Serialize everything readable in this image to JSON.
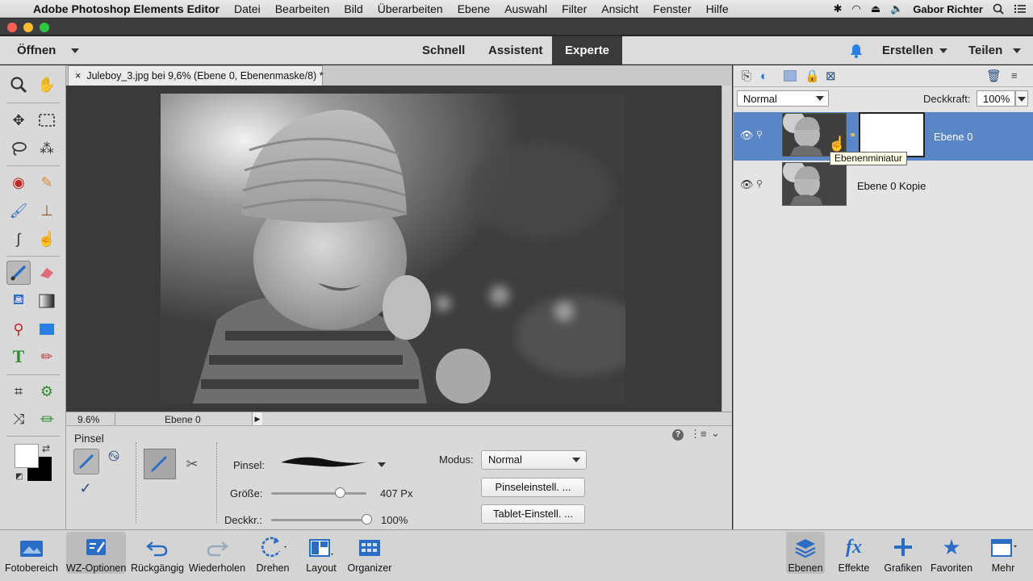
{
  "menubar": {
    "apple": "",
    "app": "Adobe Photoshop Elements Editor",
    "items": [
      "Datei",
      "Bearbeiten",
      "Bild",
      "Überarbeiten",
      "Ebene",
      "Auswahl",
      "Filter",
      "Ansicht",
      "Fenster",
      "Hilfe"
    ],
    "user": "Gabor Richter"
  },
  "topbar": {
    "open": "Öffnen",
    "modes": [
      "Schnell",
      "Assistent",
      "Experte"
    ],
    "active_mode": "Experte",
    "create": "Erstellen",
    "share": "Teilen"
  },
  "document": {
    "tab_close": "×",
    "tab_title": "Juleboy_3.jpg bei 9,6% (Ebene 0, Ebenenmaske/8) *",
    "zoom": "9.6%",
    "status_layer": "Ebene 0"
  },
  "options": {
    "tool_name": "Pinsel",
    "brush_label": "Pinsel:",
    "size_label": "Größe:",
    "size_value": "407 Px",
    "size_fraction": 0.72,
    "opacity_label": "Deckkr.:",
    "opacity_value": "100%",
    "opacity_fraction": 1.0,
    "mode_label": "Modus:",
    "mode_value": "Normal",
    "brush_settings": "Pinseleinstell. ...",
    "tablet_settings": "Tablet-Einstell. ..."
  },
  "layers_panel": {
    "blend_mode": "Normal",
    "opacity_label": "Deckkraft:",
    "opacity_value": "100%",
    "layers": [
      {
        "name": "Ebene 0",
        "selected": true,
        "has_mask": true
      },
      {
        "name": "Ebene 0 Kopie",
        "selected": false,
        "has_mask": false
      }
    ],
    "tooltip": "Ebenenminiatur"
  },
  "bottombar": {
    "left": [
      "Fotobereich",
      "WZ-Optionen",
      "Rückgängig",
      "Wiederholen",
      "Drehen",
      "Layout",
      "Organizer"
    ],
    "right": [
      "Ebenen",
      "Effekte",
      "Grafiken",
      "Favoriten",
      "Mehr"
    ]
  },
  "colors": {
    "accent": "#5b86c6",
    "active_mode_bg": "#3a3a3a",
    "icon_blue": "#2b6cc4"
  }
}
